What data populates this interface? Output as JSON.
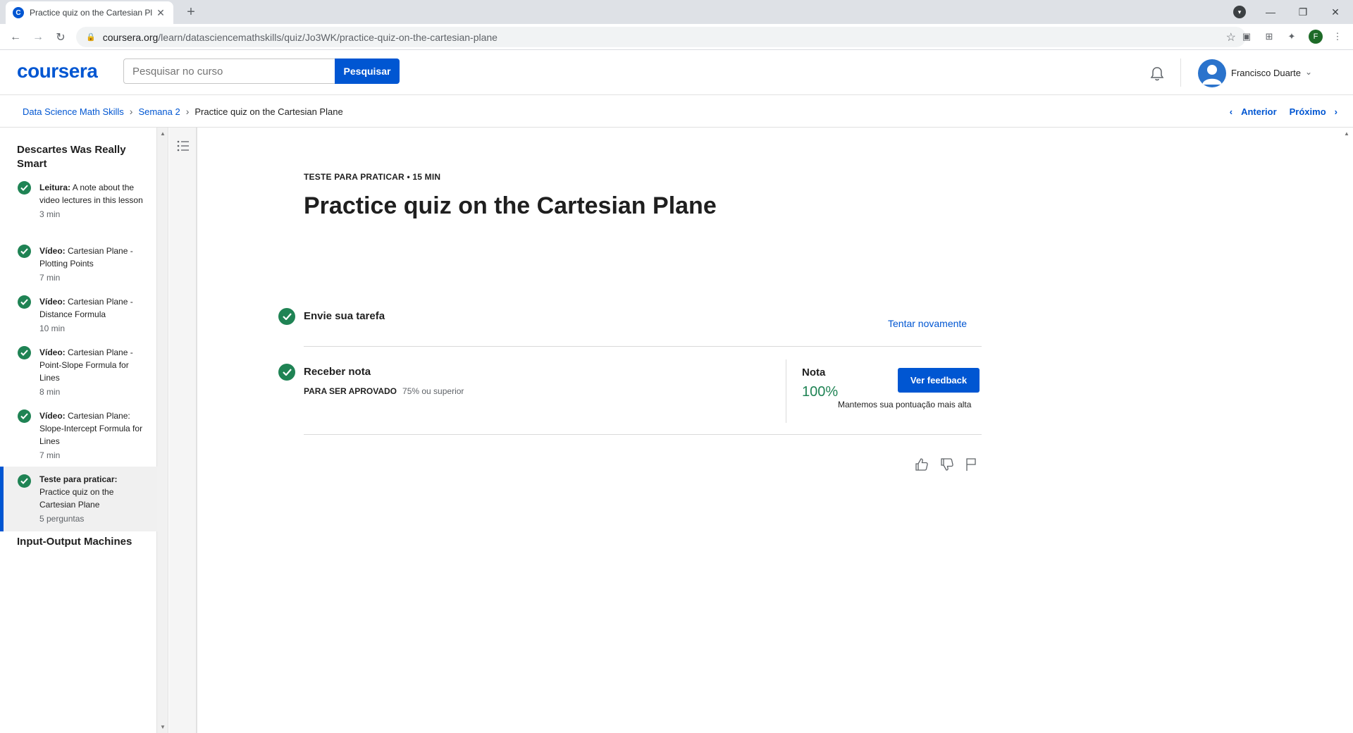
{
  "browser": {
    "tab_title": "Practice quiz on the Cartesian Pl",
    "tab_favicon": "C",
    "new_tab": "+",
    "url_host": "coursera.org",
    "url_path": "/learn/datasciencemathskills/quiz/Jo3WK/practice-quiz-on-the-cartesian-plane",
    "profile_initial": "F"
  },
  "header": {
    "logo": "coursera",
    "search_placeholder": "Pesquisar no curso",
    "search_button": "Pesquisar",
    "username": "Francisco Duarte"
  },
  "breadcrumb": {
    "items": [
      "Data Science Math Skills",
      "Semana 2",
      "Practice quiz on the Cartesian Plane"
    ],
    "prev": "Anterior",
    "next": "Próximo"
  },
  "sidebar": {
    "module1_title": "Descartes Was Really Smart",
    "items": [
      {
        "type": "Leitura:",
        "title": "A note about the video lectures in this lesson",
        "duration": "3 min"
      },
      {
        "type": "Vídeo:",
        "title": "Cartesian Plane - Plotting Points",
        "duration": "7 min"
      },
      {
        "type": "Vídeo:",
        "title": "Cartesian Plane - Distance Formula",
        "duration": "10 min"
      },
      {
        "type": "Vídeo:",
        "title": "Cartesian Plane - Point-Slope Formula for Lines",
        "duration": "8 min"
      },
      {
        "type": "Vídeo:",
        "title": "Cartesian Plane: Slope-Intercept Formula for Lines",
        "duration": "7 min"
      },
      {
        "type": "Teste para praticar:",
        "title": "Practice quiz on the Cartesian Plane",
        "duration": "5 perguntas"
      }
    ],
    "module2_title": "Input-Output Machines"
  },
  "main": {
    "eyebrow": "TESTE PARA PRATICAR • 15 MIN",
    "title": "Practice quiz on the Cartesian Plane",
    "step1_label": "Envie sua tarefa",
    "retry": "Tentar novamente",
    "step2_label": "Receber nota",
    "pass_label": "PARA SER APROVADO",
    "pass_value": "75% ou superior",
    "grade_label": "Nota",
    "grade_value": "100%",
    "feedback_button": "Ver feedback",
    "keep_note": "Mantemos sua pontuação mais alta"
  },
  "colors": {
    "brand": "#0056d2",
    "success": "#1f8354"
  }
}
